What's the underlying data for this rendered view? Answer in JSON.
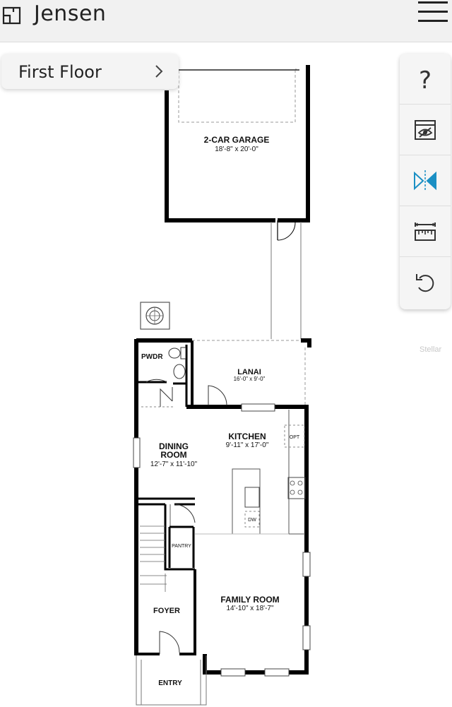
{
  "header": {
    "title": "Jensen",
    "logo_icon": "floorplan-icon",
    "menu_icon": "hamburger-menu-icon"
  },
  "floor_selector": {
    "label": "First Floor",
    "icon": "chevron-right-icon"
  },
  "toolbar": {
    "help_label": "?",
    "items": [
      "help-icon",
      "furniture-visibility-icon",
      "mirror-icon",
      "measure-icon",
      "undo-icon"
    ],
    "accent_color": "#1a8fc4"
  },
  "rooms": {
    "garage": {
      "name": "2-CAR GARAGE",
      "size": "18'-8\" x 20'-0\""
    },
    "lanai": {
      "name": "LANAI",
      "size": "16'-0\" x 9'-0\""
    },
    "powder": {
      "name": "PWDR"
    },
    "kitchen": {
      "name": "KITCHEN",
      "size": "9'-11\" x 17'-0\""
    },
    "dining_line1": "DINING",
    "dining_line2": "ROOM",
    "dining_size": "12'-7\" x 11'-10\"",
    "pantry": {
      "name": "PANTRY"
    },
    "family": {
      "name": "FAMILY ROOM",
      "size": "14'-10\" x 18'-7\""
    },
    "foyer": {
      "name": "FOYER"
    },
    "entry": {
      "name": "ENTRY"
    },
    "opt": "OPT",
    "dw": "DW"
  },
  "watermark": "Stellar"
}
